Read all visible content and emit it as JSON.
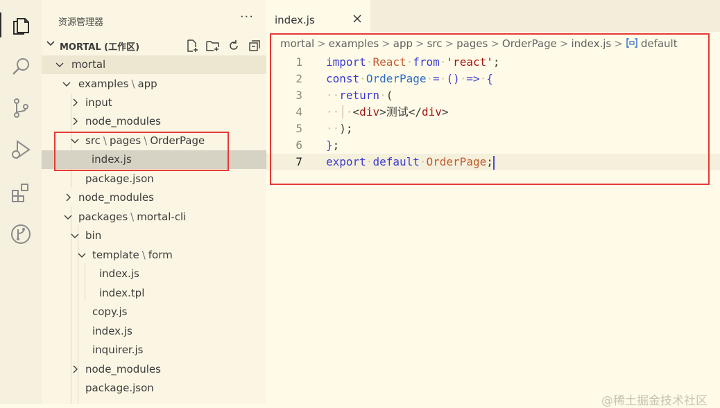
{
  "activity_bar": {
    "items": [
      {
        "icon": "files-icon"
      },
      {
        "icon": "search-icon"
      },
      {
        "icon": "source-control-icon"
      },
      {
        "icon": "run-debug-icon"
      },
      {
        "icon": "extensions-icon"
      },
      {
        "icon": "git-graph-icon"
      }
    ]
  },
  "sidebar": {
    "title": "资源管理器",
    "more": "···",
    "workspace": "MORTAL (工作区)",
    "tree": [
      {
        "label_parts": [
          "mortal"
        ]
      },
      {
        "label_parts": [
          "examples",
          "app"
        ]
      },
      {
        "label_parts": [
          "input"
        ]
      },
      {
        "label_parts": [
          "node_modules"
        ]
      },
      {
        "label_parts": [
          "src",
          "pages",
          "OrderPage"
        ]
      },
      {
        "label_parts": [
          "index.js"
        ]
      },
      {
        "label_parts": [
          "package.json"
        ]
      },
      {
        "label_parts": [
          "node_modules"
        ]
      },
      {
        "label_parts": [
          "packages",
          "mortal-cli"
        ]
      },
      {
        "label_parts": [
          "bin"
        ]
      },
      {
        "label_parts": [
          "template",
          "form"
        ]
      },
      {
        "label_parts": [
          "index.js"
        ]
      },
      {
        "label_parts": [
          "index.tpl"
        ]
      },
      {
        "label_parts": [
          "copy.js"
        ]
      },
      {
        "label_parts": [
          "index.js"
        ]
      },
      {
        "label_parts": [
          "inquirer.js"
        ]
      },
      {
        "label_parts": [
          "node_modules"
        ]
      },
      {
        "label_parts": [
          "package.json"
        ]
      }
    ],
    "separator": "\\"
  },
  "editor": {
    "tab": {
      "label": "index.js",
      "close": "×"
    },
    "breadcrumb": [
      "mortal",
      "examples",
      "app",
      "src",
      "pages",
      "OrderPage",
      "index.js",
      "default"
    ],
    "breadcrumb_separator": ">",
    "lines": [
      {
        "num": "1",
        "tokens": [
          [
            "kw",
            "import"
          ],
          [
            "ws",
            "·"
          ],
          [
            "cls",
            "React"
          ],
          [
            "ws",
            "·"
          ],
          [
            "kw",
            "from"
          ],
          [
            "ws",
            "·"
          ],
          [
            "str",
            "'react'"
          ],
          [
            "",
            ";"
          ]
        ]
      },
      {
        "num": "2",
        "tokens": [
          [
            "kw",
            "const"
          ],
          [
            "ws",
            "·"
          ],
          [
            "fn",
            "OrderPage"
          ],
          [
            "ws",
            "·"
          ],
          [
            "op",
            "="
          ],
          [
            "ws",
            "·"
          ],
          [
            "kw",
            "()"
          ],
          [
            "ws",
            "·"
          ],
          [
            "op",
            "=>"
          ],
          [
            "ws",
            "·"
          ],
          [
            "kw",
            "{"
          ]
        ]
      },
      {
        "num": "3",
        "tokens": [
          [
            "ws",
            "··"
          ],
          [
            "kw",
            "return"
          ],
          [
            "ws",
            "·"
          ],
          [
            "",
            "("
          ]
        ]
      },
      {
        "num": "4",
        "tokens": [
          [
            "ws",
            "··│·"
          ],
          [
            "",
            "<"
          ],
          [
            "tag",
            "div"
          ],
          [
            "",
            ">测试</"
          ],
          [
            "tag",
            "div"
          ],
          [
            "",
            ">"
          ]
        ]
      },
      {
        "num": "5",
        "tokens": [
          [
            "ws",
            "··"
          ],
          [
            "",
            ");"
          ]
        ]
      },
      {
        "num": "6",
        "tokens": [
          [
            "kw",
            "}"
          ],
          [
            "",
            ";"
          ]
        ]
      },
      {
        "num": "7",
        "tokens": [
          [
            "kw",
            "export"
          ],
          [
            "ws",
            "·"
          ],
          [
            "kw",
            "default"
          ],
          [
            "ws",
            "·"
          ],
          [
            "cls",
            "OrderPage"
          ],
          [
            "",
            ";"
          ]
        ]
      }
    ],
    "current_line": "7"
  },
  "watermark": "@稀土掘金技术社区",
  "colors": {
    "highlight_red": "#e53935",
    "keyword": "#3b3bd0",
    "string": "#a31515",
    "class": "#c25b2b"
  }
}
